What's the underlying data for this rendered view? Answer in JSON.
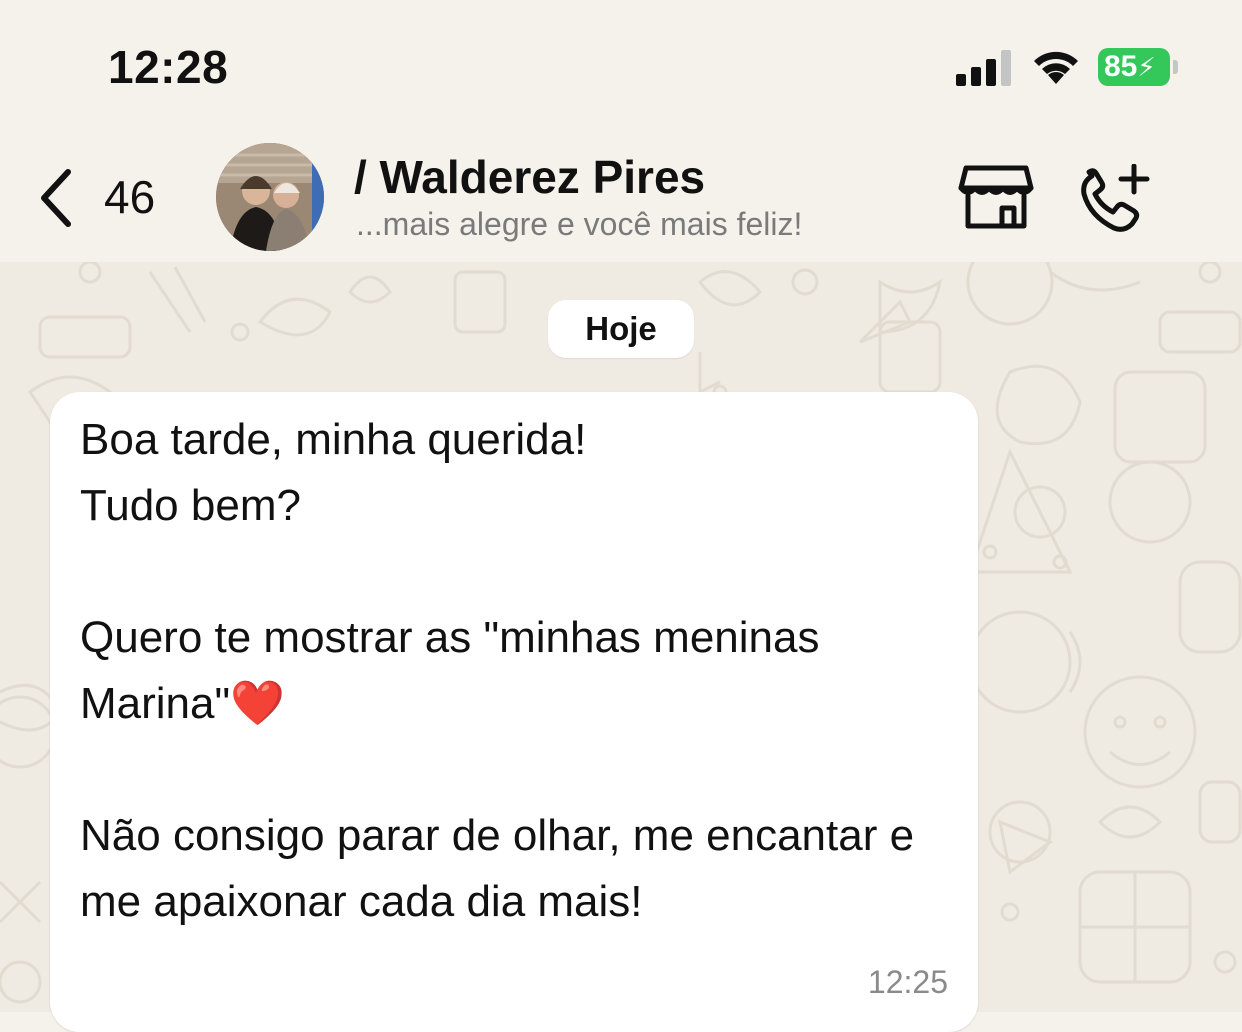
{
  "status_bar": {
    "time": "12:28",
    "battery_percent": "85",
    "signal_icon": "cellular-signal-icon",
    "wifi_icon": "wifi-icon",
    "battery_color": "#34c759"
  },
  "header": {
    "back_icon": "chevron-left-icon",
    "unread_count": "46",
    "contact_name": "/ Walderez Pires",
    "contact_status": "...mais alegre e você mais feliz!",
    "catalog_icon": "storefront-icon",
    "call_icon": "add-call-icon"
  },
  "chat": {
    "date_separator": "Hoje",
    "messages": [
      {
        "direction": "incoming",
        "text": "Boa tarde, minha querida!\nTudo bem?\n\nQuero te mostrar as \"minhas meninas Marina\"❤️\n\nNão consigo parar de olhar, me encantar e me apaixonar cada dia mais!",
        "time": "12:25"
      }
    ]
  },
  "colors": {
    "background": "#f5f2ec",
    "wallpaper": "#efeae2",
    "bubble": "#ffffff"
  }
}
